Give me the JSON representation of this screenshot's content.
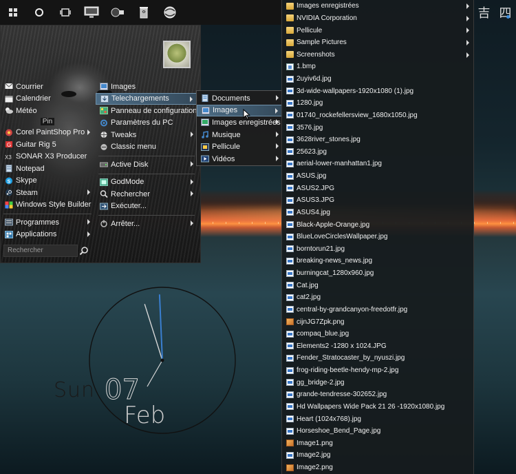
{
  "taskbar": {
    "icons": [
      "windows-icon",
      "circle-search-icon",
      "task-view-icon",
      "monitor-icon",
      "video-camera-icon",
      "trash-icon",
      "globe-icon"
    ],
    "tray_chars": [
      "吉",
      "四"
    ]
  },
  "start_menu": {
    "pinned_top": [
      {
        "label": "Courrier",
        "icon": "mail-icon"
      },
      {
        "label": "Calendrier",
        "icon": "calendar-icon"
      },
      {
        "label": "Météo",
        "icon": "weather-icon"
      }
    ],
    "pin_label": "Pin",
    "pinned_apps": [
      {
        "label": "Corel PaintShop Pro",
        "icon": "paintshop-icon",
        "has_submenu": true
      },
      {
        "label": "Guitar Rig 5",
        "icon": "guitar-rig-icon",
        "has_submenu": false
      },
      {
        "label": "SONAR X3 Producer",
        "icon": "sonar-icon",
        "has_submenu": false
      },
      {
        "label": "Notepad",
        "icon": "notepad-icon",
        "has_submenu": false
      },
      {
        "label": "Skype",
        "icon": "skype-icon",
        "has_submenu": false
      },
      {
        "label": "Steam",
        "icon": "steam-icon",
        "has_submenu": true
      },
      {
        "label": "Windows Style Builder",
        "icon": "style-builder-icon",
        "has_submenu": false
      }
    ],
    "bottom_left": [
      {
        "label": "Programmes",
        "icon": "programs-icon",
        "has_submenu": true
      },
      {
        "label": "Applications",
        "icon": "apps-icon",
        "has_submenu": true
      }
    ],
    "search_placeholder": "Rechercher",
    "mid_column": [
      {
        "label": "Images",
        "icon": "images-icon",
        "has_submenu": false
      },
      {
        "label": "Telechargements",
        "icon": "downloads-icon",
        "has_submenu": true,
        "highlighted": true
      },
      {
        "label": "Panneau de configuration",
        "icon": "control-panel-icon",
        "has_submenu": false
      },
      {
        "label": "Paramètres du PC",
        "icon": "settings-icon",
        "has_submenu": false
      },
      {
        "label": "Tweaks",
        "icon": "tweaks-icon",
        "has_submenu": true
      },
      {
        "label": "Classic menu",
        "icon": "classic-menu-icon",
        "has_submenu": false
      },
      {
        "label": "Active Disk",
        "icon": "disk-icon",
        "has_submenu": true
      },
      {
        "label": "GodMode",
        "icon": "godmode-icon",
        "has_submenu": true
      },
      {
        "label": "Rechercher",
        "icon": "search-icon",
        "has_submenu": true
      },
      {
        "label": "Exécuter...",
        "icon": "run-icon",
        "has_submenu": false
      },
      {
        "label": "Arrêter...",
        "icon": "power-icon",
        "has_submenu": true
      }
    ]
  },
  "downloads_submenu": [
    {
      "label": "Documents",
      "icon": "documents-icon"
    },
    {
      "label": "Images",
      "icon": "images-icon",
      "highlighted": true
    },
    {
      "label": "Images enregistrées",
      "icon": "saved-images-icon"
    },
    {
      "label": "Musique",
      "icon": "music-icon"
    },
    {
      "label": "Pellicule",
      "icon": "film-icon"
    },
    {
      "label": "Vidéos",
      "icon": "videos-icon"
    }
  ],
  "file_list": [
    {
      "label": "Images enregistrées",
      "type": "folder",
      "has_submenu": true
    },
    {
      "label": "NVIDIA Corporation",
      "type": "folder",
      "has_submenu": true
    },
    {
      "label": "Pellicule",
      "type": "folder",
      "has_submenu": true
    },
    {
      "label": "Sample Pictures",
      "type": "folder",
      "has_submenu": true
    },
    {
      "label": "Screenshots",
      "type": "folder",
      "has_submenu": true
    },
    {
      "label": "1.bmp",
      "type": "bmp"
    },
    {
      "label": "2uyiv6d.jpg",
      "type": "img"
    },
    {
      "label": "3d-wide-wallpapers-1920x1080 (1).jpg",
      "type": "img"
    },
    {
      "label": "1280.jpg",
      "type": "img"
    },
    {
      "label": "01740_rockefellersview_1680x1050.jpg",
      "type": "img"
    },
    {
      "label": "3576.jpg",
      "type": "img"
    },
    {
      "label": "3628river_stones.jpg",
      "type": "img"
    },
    {
      "label": "25623.jpg",
      "type": "img"
    },
    {
      "label": "aerial-lower-manhattan1.jpg",
      "type": "img"
    },
    {
      "label": "ASUS.jpg",
      "type": "img"
    },
    {
      "label": "ASUS2.JPG",
      "type": "img"
    },
    {
      "label": "ASUS3.JPG",
      "type": "img"
    },
    {
      "label": "ASUS4.jpg",
      "type": "img"
    },
    {
      "label": "Black-Apple-Orange.jpg",
      "type": "img"
    },
    {
      "label": "BlueLoveCirclesWallpaper.jpg",
      "type": "img"
    },
    {
      "label": "borntorun21.jpg",
      "type": "img"
    },
    {
      "label": "breaking-news_news.jpg",
      "type": "img"
    },
    {
      "label": "burningcat_1280x960.jpg",
      "type": "img"
    },
    {
      "label": "Cat.jpg",
      "type": "img"
    },
    {
      "label": "cat2.jpg",
      "type": "img"
    },
    {
      "label": "central-by-grandcanyon-freedotfr.jpg",
      "type": "img"
    },
    {
      "label": "cijnJG7Zpk.png",
      "type": "png"
    },
    {
      "label": "compaq_blue.jpg",
      "type": "img"
    },
    {
      "label": "Elements2 -1280 x 1024.JPG",
      "type": "img"
    },
    {
      "label": "Fender_Stratocaster_by_nyuszi.jpg",
      "type": "img"
    },
    {
      "label": "frog-riding-beetle-hendy-mp-2.jpg",
      "type": "img"
    },
    {
      "label": "gg_bridge-2.jpg",
      "type": "img"
    },
    {
      "label": "grande-tendresse-302652.jpg",
      "type": "img"
    },
    {
      "label": "Hd Wallpapers Wide Pack  21  26 -1920x1080.jpg",
      "type": "img"
    },
    {
      "label": "Heart (1024x768).jpg",
      "type": "img"
    },
    {
      "label": "Horseshoe_Bend_Page.jpg",
      "type": "img"
    },
    {
      "label": "Image1.png",
      "type": "png"
    },
    {
      "label": "Image2.jpg",
      "type": "img"
    },
    {
      "label": "Image2.png",
      "type": "png"
    }
  ],
  "clock_widget": {
    "day": "Sun",
    "date": "07",
    "month": "Feb",
    "hour_hand_time": "11:55",
    "colors": {
      "hour_hand": "#d8d8d8",
      "minute_hand": "#3a7fd0",
      "ring": "#111111"
    }
  }
}
